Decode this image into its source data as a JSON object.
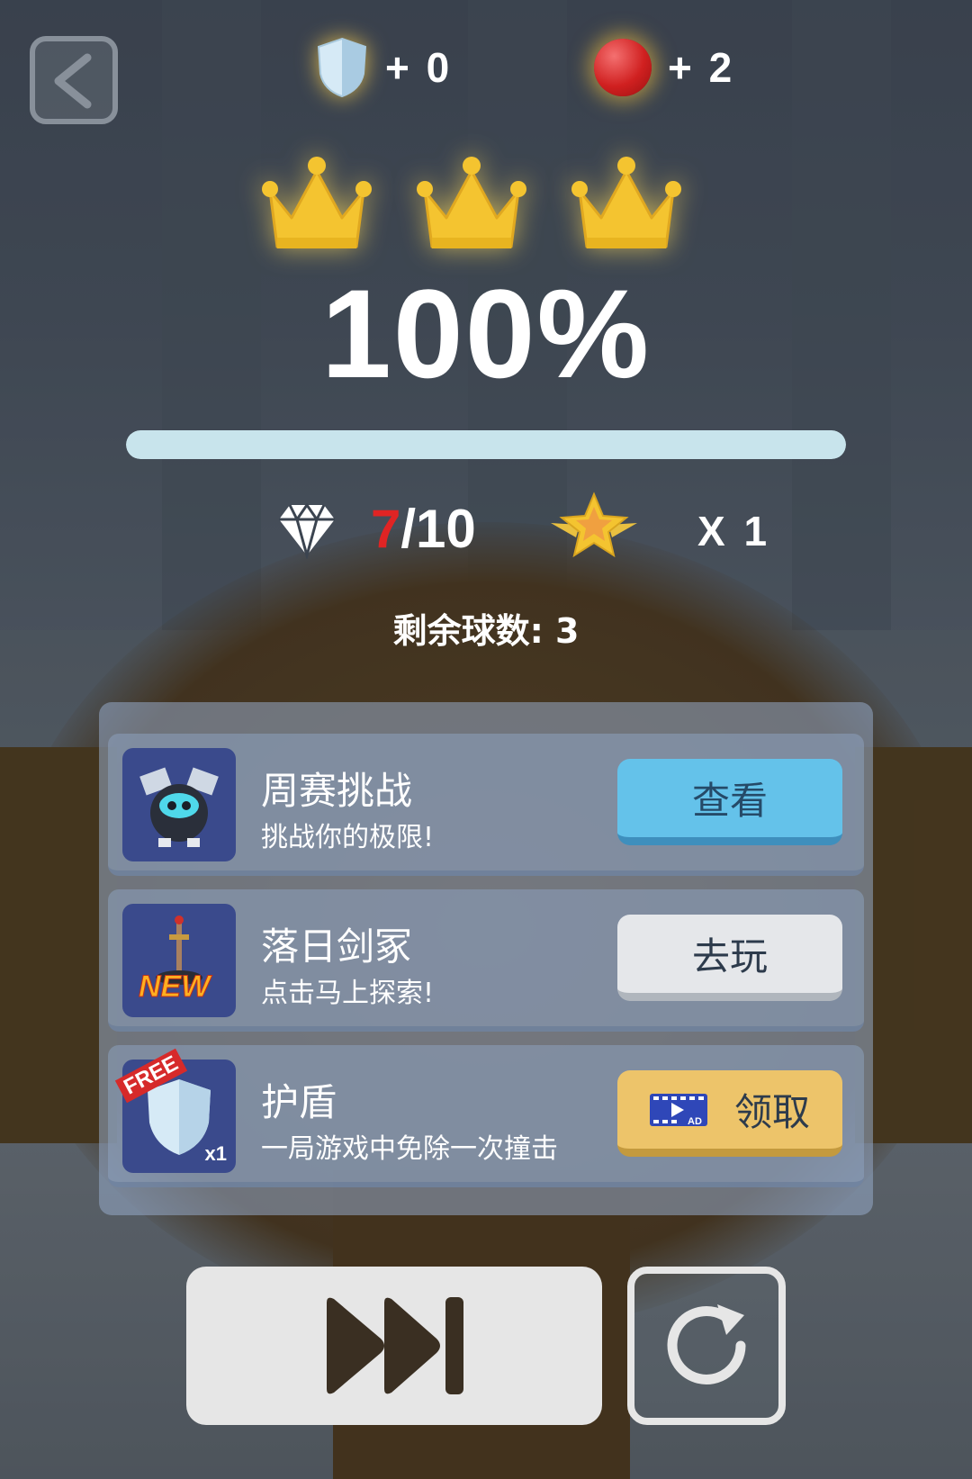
{
  "rewards": {
    "shield_text": "+ 0",
    "ball_text": "+ 2"
  },
  "crowns_earned": 3,
  "crowns_total": 3,
  "completion": {
    "text": "100%",
    "progress": 1.0
  },
  "gems": {
    "collected": "7",
    "total_text": "/10"
  },
  "stars": {
    "multiplier_text": "X 1"
  },
  "balls_remaining_text": "剩余球数: 3",
  "cards": [
    {
      "title": "周赛挑战",
      "subtitle": "挑战你的极限!",
      "button": "查看",
      "icon": "robot-icon"
    },
    {
      "title": "落日剑冢",
      "subtitle": "点击马上探索!",
      "button": "去玩",
      "icon": "sword-icon",
      "tag": "NEW"
    },
    {
      "title": "护盾",
      "subtitle": "一局游戏中免除一次撞击",
      "button": "领取",
      "icon": "shield-icon",
      "tag": "FREE",
      "count": "x1"
    }
  ],
  "colors": {
    "accent_blue": "#64c2ea",
    "accent_gold": "#edc46a",
    "gem_red": "#e02424",
    "crown_gold": "#f4c430"
  }
}
